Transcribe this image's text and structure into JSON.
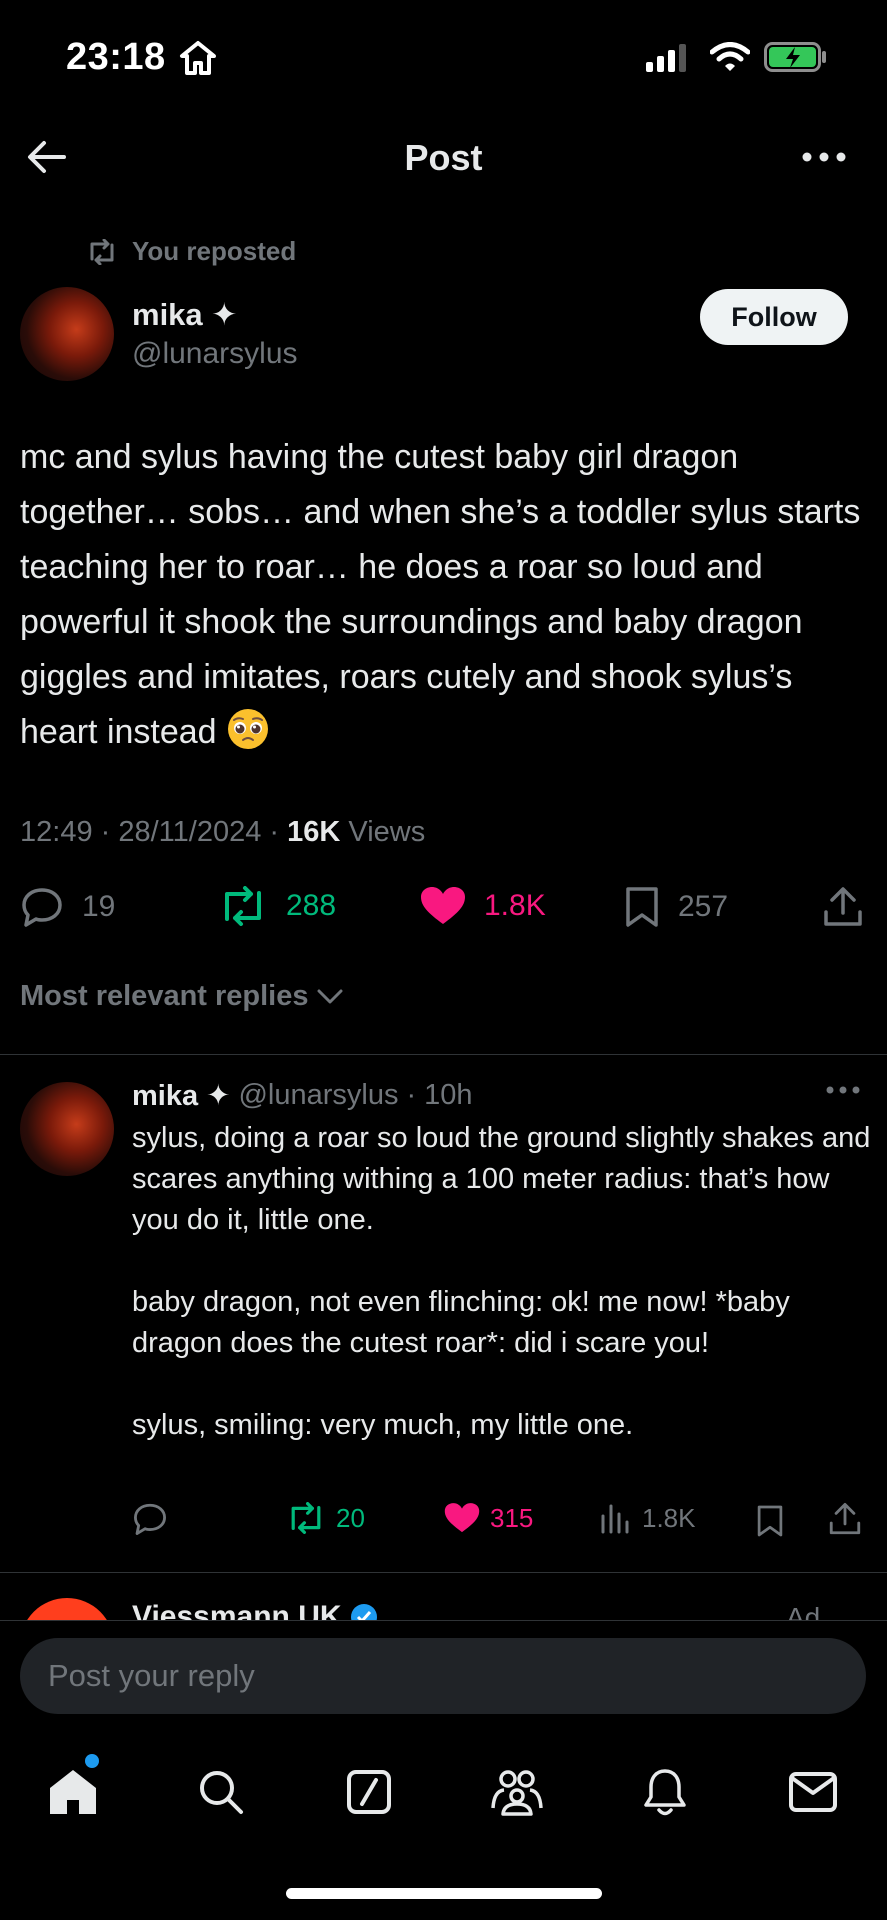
{
  "status_bar": {
    "time": "23:18",
    "icons": [
      "home-icon",
      "signal-icon",
      "wifi-icon",
      "battery-charging-icon"
    ]
  },
  "header": {
    "title": "Post",
    "back_icon": "arrow-left-icon",
    "more_icon": "more-horizontal-icon"
  },
  "post": {
    "repost_label": "You reposted",
    "author": {
      "name": "mika ✦",
      "handle": "@lunarsylus"
    },
    "follow_label": "Follow",
    "body": "mc and sylus having the cutest baby girl dragon together… sobs… and when she’s a toddler sylus starts teaching her to roar… he does a roar so loud and powerful it shook the surroundings and baby dragon giggles and imitates, roars cutely and shook sylus’s heart instead",
    "emoji": "pleading-face-emoji",
    "time": "12:49",
    "date": "28/11/2024",
    "views_count": "16K",
    "views_label": "Views",
    "stats": {
      "replies": "19",
      "reposts": "288",
      "likes": "1.8K",
      "bookmarks": "257"
    }
  },
  "replies_sort_label": "Most relevant replies",
  "reply": {
    "name": "mika ✦",
    "handle": "@lunarsylus",
    "separator": "·",
    "age": "10h",
    "body": "sylus, doing a roar so loud the ground slightly shakes and scares anything withing a 100 meter radius: that’s how you do it, little one.\n\nbaby dragon, not even flinching: ok! me now! *baby dragon does the cutest roar*: did i scare you!\n\nsylus, smiling: very much, my little one.",
    "stats": {
      "reposts": "20",
      "likes": "315",
      "views": "1.8K"
    }
  },
  "ad_peek": {
    "name": "Viessmann UK",
    "label": "Ad"
  },
  "composer": {
    "placeholder": "Post your reply"
  },
  "bottom_nav": [
    "home-icon",
    "search-icon",
    "grok-icon",
    "communities-icon",
    "notifications-icon",
    "messages-icon"
  ],
  "colors": {
    "background": "#000000",
    "text": "#e7e9ea",
    "muted": "#71767b",
    "repost_green": "#00ba7c",
    "like_pink": "#f91880",
    "accent_blue": "#1d9bf0"
  }
}
